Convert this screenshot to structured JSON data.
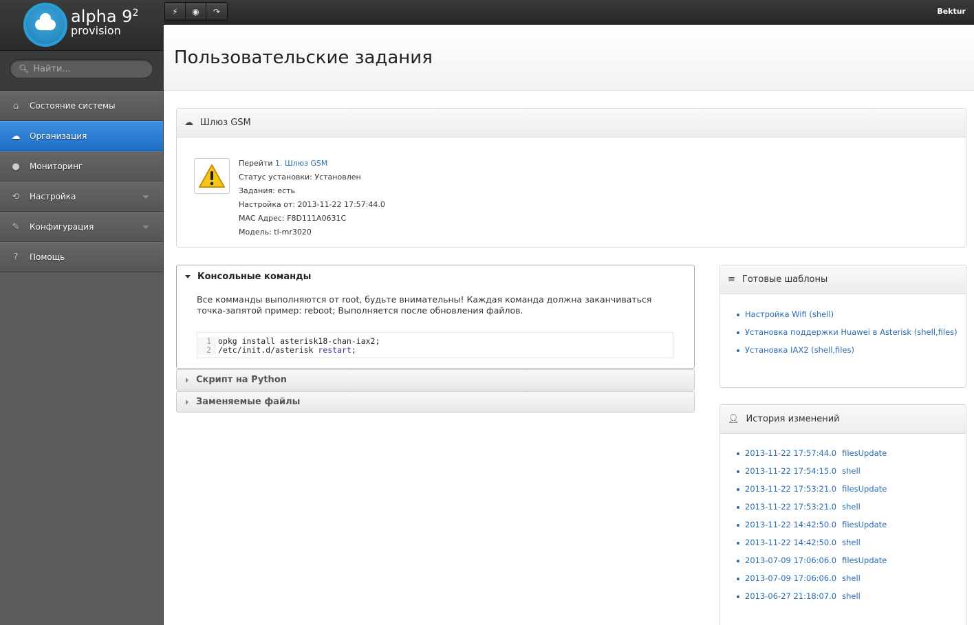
{
  "app": {
    "brand_name": "alpha 9",
    "brand_sup": "2",
    "brand_sub": "provision",
    "user": "Bektur"
  },
  "toolbar": [
    {
      "name": "flash-button",
      "glyph": "⚡"
    },
    {
      "name": "eye-button",
      "glyph": "◉"
    },
    {
      "name": "refresh-button",
      "glyph": "↷"
    }
  ],
  "search": {
    "placeholder": "Найти..."
  },
  "nav": {
    "items": [
      {
        "label": "Состояние системы",
        "icon": "home-icon",
        "glyph": "⌂"
      },
      {
        "label": "Организация",
        "icon": "cloud-icon",
        "glyph": "☁"
      },
      {
        "label": "Мониторинг",
        "icon": "map-pin-icon",
        "glyph": "●"
      },
      {
        "label": "Настройка",
        "icon": "sync-icon",
        "glyph": "⟲"
      },
      {
        "label": "Конфигурация",
        "icon": "wrench-icon",
        "glyph": "✎"
      },
      {
        "label": "Помощь",
        "icon": "question-icon",
        "glyph": "?"
      }
    ]
  },
  "page": {
    "title": "Пользовательские задания"
  },
  "gateway": {
    "title": "Шлюз GSM",
    "goto_label": "Перейти",
    "goto_link": "1. Шлюз GSM",
    "install_status": "Статус установки: Установлен",
    "tasks": "Задания: есть",
    "configured": "Настройка от: 2013-11-22 17:57:44.0",
    "mac": "MAC Адрес: F8D111A0631C",
    "model": "Модель: tl-mr3020"
  },
  "console": {
    "title": "Консольные команды",
    "description": "Все комманды выполняются от root, будьте внимательны! Каждая команда должна заканчиваться точка-запятой пример: reboot; Выполняется после обновления файлов.",
    "code": [
      {
        "n": "1",
        "text": "opkg install asterisk18-chan-iax2;"
      },
      {
        "n": "2",
        "pre": "/etc/init.d/asterisk ",
        "kw": "restart",
        "post": ";"
      }
    ]
  },
  "python": {
    "title": "Скрипт на Python"
  },
  "files": {
    "title": "Заменяемые файлы"
  },
  "templates": {
    "title": "Готовые шаблоны",
    "items": [
      "Настройка Wifi (shell)",
      "Установка поддержки Huawei в Asterisk (shell,files)",
      "Установка IAX2 (shell,files)"
    ]
  },
  "history": {
    "title": "История изменений",
    "items": [
      {
        "time": "2013-11-22 17:57:44.0",
        "action": "filesUpdate"
      },
      {
        "time": "2013-11-22 17:54:15.0",
        "action": "shell"
      },
      {
        "time": "2013-11-22 17:53:21.0",
        "action": "filesUpdate"
      },
      {
        "time": "2013-11-22 17:53:21.0",
        "action": "shell"
      },
      {
        "time": "2013-11-22 14:42:50.0",
        "action": "filesUpdate"
      },
      {
        "time": "2013-11-22 14:42:50.0",
        "action": "shell"
      },
      {
        "time": "2013-07-09 17:06:06.0",
        "action": "filesUpdate"
      },
      {
        "time": "2013-07-09 17:06:06.0",
        "action": "shell"
      },
      {
        "time": "2013-06-27 21:18:07.0",
        "action": "shell"
      }
    ]
  }
}
